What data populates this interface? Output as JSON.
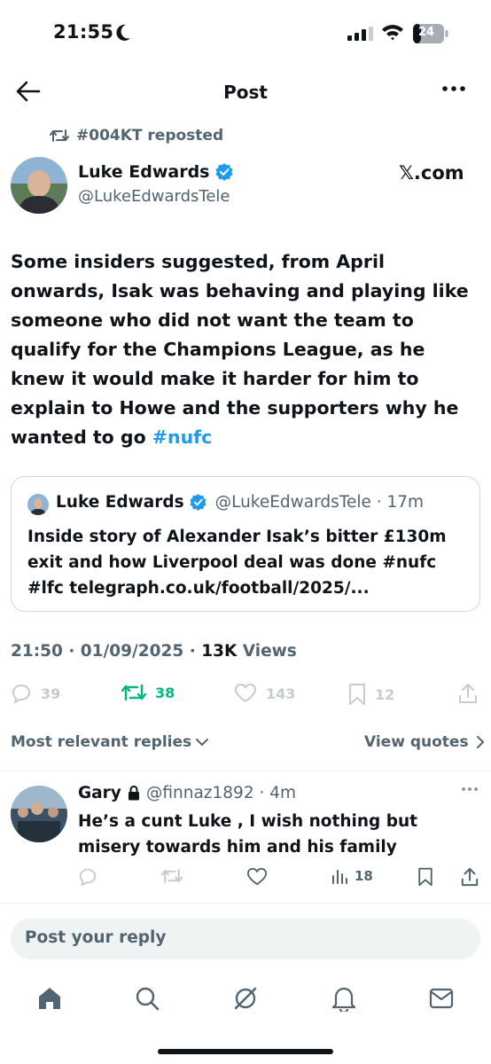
{
  "status_bar": {
    "time": "21:55",
    "battery": "24"
  },
  "header": {
    "title": "Post",
    "back_icon": "arrow-left-icon",
    "more_icon": "more-horizontal-icon"
  },
  "repost": {
    "text": "#004KT reposted"
  },
  "author": {
    "name": "Luke Edwards",
    "handle": "@LukeEdwardsTele",
    "verified": true
  },
  "source_badge": "𝕏.com",
  "tweet": {
    "text_before_hashtag": "Some insiders suggested, from April onwards, Isak was behaving and playing like someone who did not want the team to qualify for the Champions League, as he knew it would make it harder for him to explain to Howe and the supporters why he wanted to go ",
    "hashtag": "#nufc"
  },
  "quote": {
    "name": "Luke Edwards",
    "handle_time": "@LukeEdwardsTele · 17m",
    "text": "Inside story of Alexander Isak’s bitter £130m exit and how Liverpool deal was done #nufc #lfc  telegraph.co.uk/football/2025/..."
  },
  "meta": {
    "timestamp": "21:50 · 01/09/2025 · ",
    "views_count": "13K",
    "views_label": " Views"
  },
  "actions": {
    "replies": "39",
    "reposts": "38",
    "likes": "143",
    "bookmarks": "12"
  },
  "replies_section": {
    "sort_label": "Most relevant replies",
    "view_quotes": "View quotes"
  },
  "reply": {
    "name": "Gary",
    "handle_time": "@finnaz1892 · 4m",
    "text": "He’s a cunt Luke , I wish nothing but misery towards him and his family",
    "views": "18"
  },
  "composer": {
    "placeholder": "Post your reply"
  },
  "tabs": [
    "home-icon",
    "search-icon",
    "grok-icon",
    "notifications-icon",
    "messages-icon"
  ],
  "colors": {
    "accent": "#1d9bf0",
    "repost_green": "#00ba7c",
    "muted": "#536471",
    "text": "#0f1419"
  }
}
